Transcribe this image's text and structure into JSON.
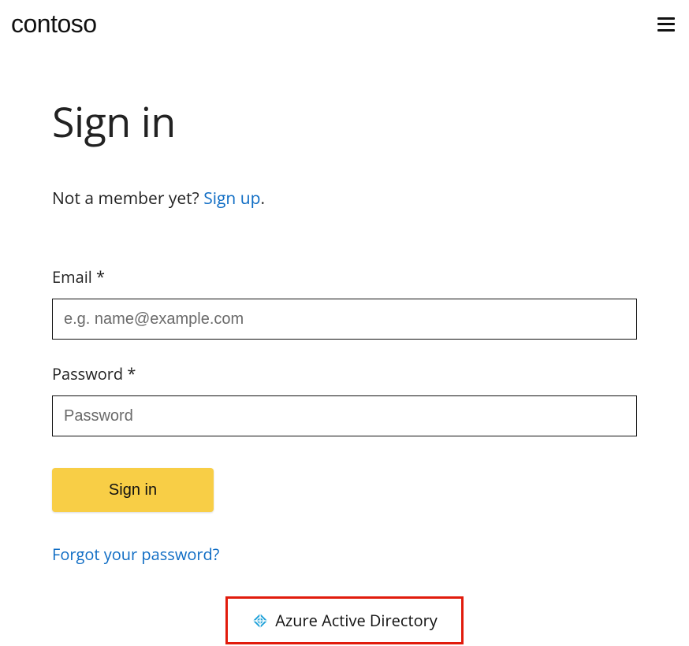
{
  "header": {
    "logo_text": "contoso"
  },
  "page": {
    "title": "Sign in",
    "not_member_text": "Not a member yet? ",
    "signup_link": "Sign up",
    "not_member_suffix": "."
  },
  "form": {
    "email_label": "Email *",
    "email_placeholder": "e.g. name@example.com",
    "password_label": "Password *",
    "password_placeholder": "Password",
    "signin_button": "Sign in",
    "forgot_link": "Forgot your password?"
  },
  "sso": {
    "azure_label": "Azure Active Directory"
  },
  "colors": {
    "link": "#0e6cc4",
    "button_bg": "#f8ce46",
    "highlight_border": "#e11b0c",
    "azure_icon": "#1fa1d9"
  }
}
